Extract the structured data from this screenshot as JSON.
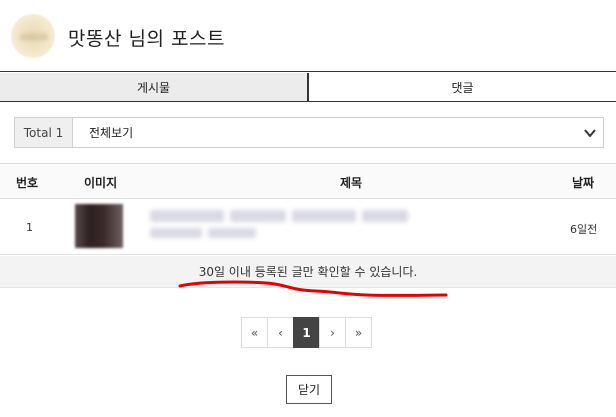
{
  "header": {
    "title": "맛똥산 님의 포스트"
  },
  "tabs": [
    {
      "label": "게시물",
      "active": true
    },
    {
      "label": "댓글",
      "active": false
    }
  ],
  "filter": {
    "total_label": "Total 1",
    "selected": "전체보기"
  },
  "table": {
    "columns": [
      "번호",
      "이미지",
      "제목",
      "날짜"
    ],
    "rows": [
      {
        "no": "1",
        "date": "6일전"
      }
    ]
  },
  "notice": "30일 이내 등록된 글만 확인할 수 있습니다.",
  "pagination": {
    "first": "«",
    "prev": "‹",
    "current": "1",
    "next": "›",
    "last": "»"
  },
  "close_label": "닫기",
  "colors": {
    "accent_dark": "#444444",
    "annotation_red": "#e60000",
    "tab_active_bg": "#ececec"
  }
}
